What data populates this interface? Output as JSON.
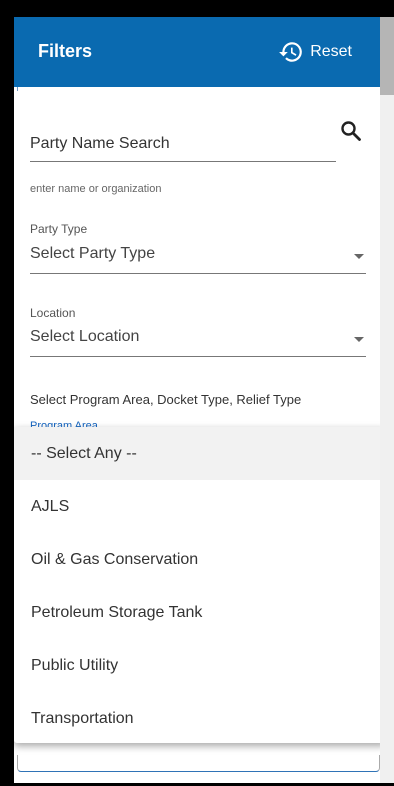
{
  "header": {
    "title": "Filters",
    "reset_label": "Reset"
  },
  "search": {
    "label": "Party Name Search",
    "hint": "enter name or organization"
  },
  "party_type": {
    "label": "Party Type",
    "value": "Select Party Type"
  },
  "location": {
    "label": "Location",
    "value": "Select Location"
  },
  "program": {
    "section_label": "Select Program Area, Docket Type, Relief Type",
    "label": "Program Area",
    "options": [
      {
        "label": "-- Select Any --"
      },
      {
        "label": "AJLS"
      },
      {
        "label": "Oil & Gas Conservation"
      },
      {
        "label": "Petroleum Storage Tank"
      },
      {
        "label": "Public Utility"
      },
      {
        "label": "Transportation"
      }
    ]
  },
  "colors": {
    "header_bg": "#0a6ab0",
    "accent": "#1565c0"
  }
}
